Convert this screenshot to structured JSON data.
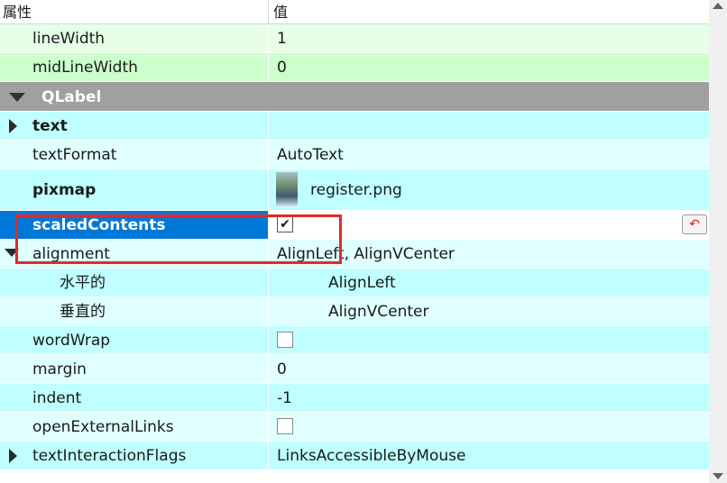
{
  "header": {
    "property": "属性",
    "value": "值"
  },
  "rows": {
    "lineWidth": {
      "name": "lineWidth",
      "value": "1"
    },
    "midLineWidth": {
      "name": "midLineWidth",
      "value": "0"
    },
    "qlabel": {
      "name": "QLabel"
    },
    "text": {
      "name": "text",
      "value": ""
    },
    "textFormat": {
      "name": "textFormat",
      "value": "AutoText"
    },
    "pixmap": {
      "name": "pixmap",
      "value": "register.png"
    },
    "scaledContents": {
      "name": "scaledContents",
      "checked": true,
      "check_glyph": "✔"
    },
    "alignment": {
      "name": "alignment",
      "value": "AlignLeft, AlignVCenter"
    },
    "horizontal": {
      "name": "水平的",
      "value": "AlignLeft"
    },
    "vertical": {
      "name": "垂直的",
      "value": "AlignVCenter"
    },
    "wordWrap": {
      "name": "wordWrap",
      "checked": false
    },
    "margin": {
      "name": "margin",
      "value": "0"
    },
    "indent": {
      "name": "indent",
      "value": "-1"
    },
    "openExternalLinks": {
      "name": "openExternalLinks",
      "checked": false
    },
    "textInteractionFlags": {
      "name": "textInteractionFlags",
      "value": "LinksAccessibleByMouse"
    }
  },
  "reset_glyph": "↶",
  "colors": {
    "frame_rows": "#ccffcc",
    "label_rows": "#bfffff",
    "category": "#a0a0a0",
    "selection": "#0078d7",
    "highlight_box": "#e02a2a"
  }
}
